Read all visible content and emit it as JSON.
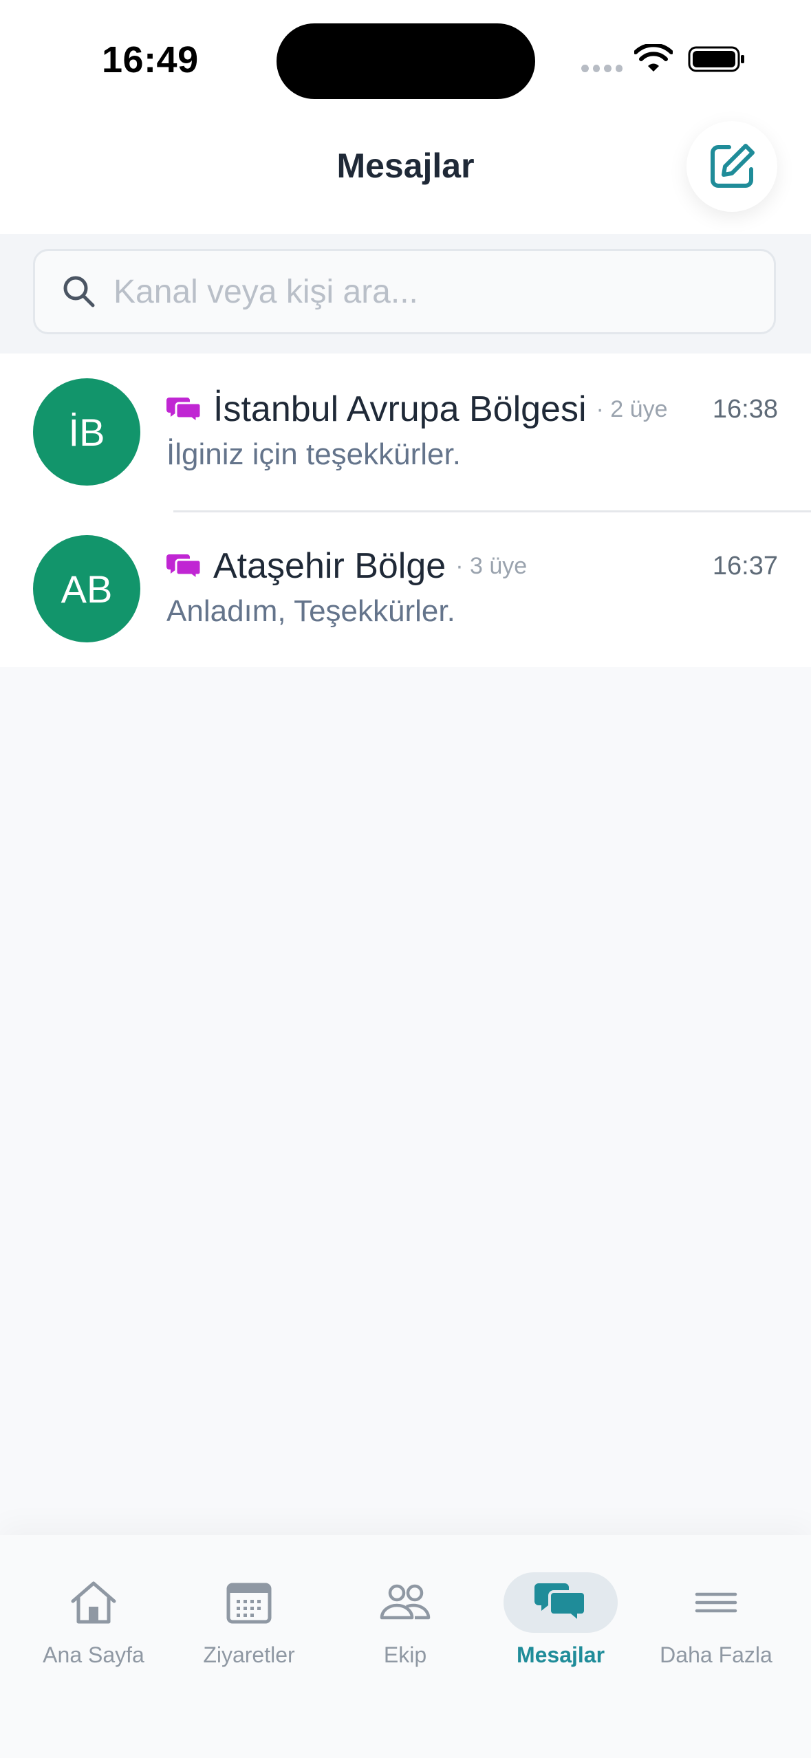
{
  "status_bar": {
    "time": "16:49"
  },
  "header": {
    "title": "Mesajlar",
    "compose_icon": "compose-icon"
  },
  "search": {
    "value": "",
    "placeholder": "Kanal veya kişi ara..."
  },
  "chats": [
    {
      "initials": "İB",
      "title": "İstanbul Avrupa Bölgesi",
      "members": "· 2 üye",
      "time": "16:38",
      "preview": "İlginiz için teşekkürler.",
      "icon": "channel-icon"
    },
    {
      "initials": "AB",
      "title": "Ataşehir Bölge",
      "members": "· 3 üye",
      "time": "16:37",
      "preview": "Anladım, Teşekkürler.",
      "icon": "channel-icon"
    }
  ],
  "tabs": [
    {
      "label": "Ana Sayfa",
      "icon": "home-icon",
      "active": false
    },
    {
      "label": "Ziyaretler",
      "icon": "calendar-icon",
      "active": false
    },
    {
      "label": "Ekip",
      "icon": "team-icon",
      "active": false
    },
    {
      "label": "Mesajlar",
      "icon": "messages-icon",
      "active": true
    },
    {
      "label": "Daha Fazla",
      "icon": "menu-icon",
      "active": false
    }
  ],
  "colors": {
    "accent": "#1f8c99",
    "avatar": "#12956b",
    "channel_icon": "#c026d3"
  }
}
